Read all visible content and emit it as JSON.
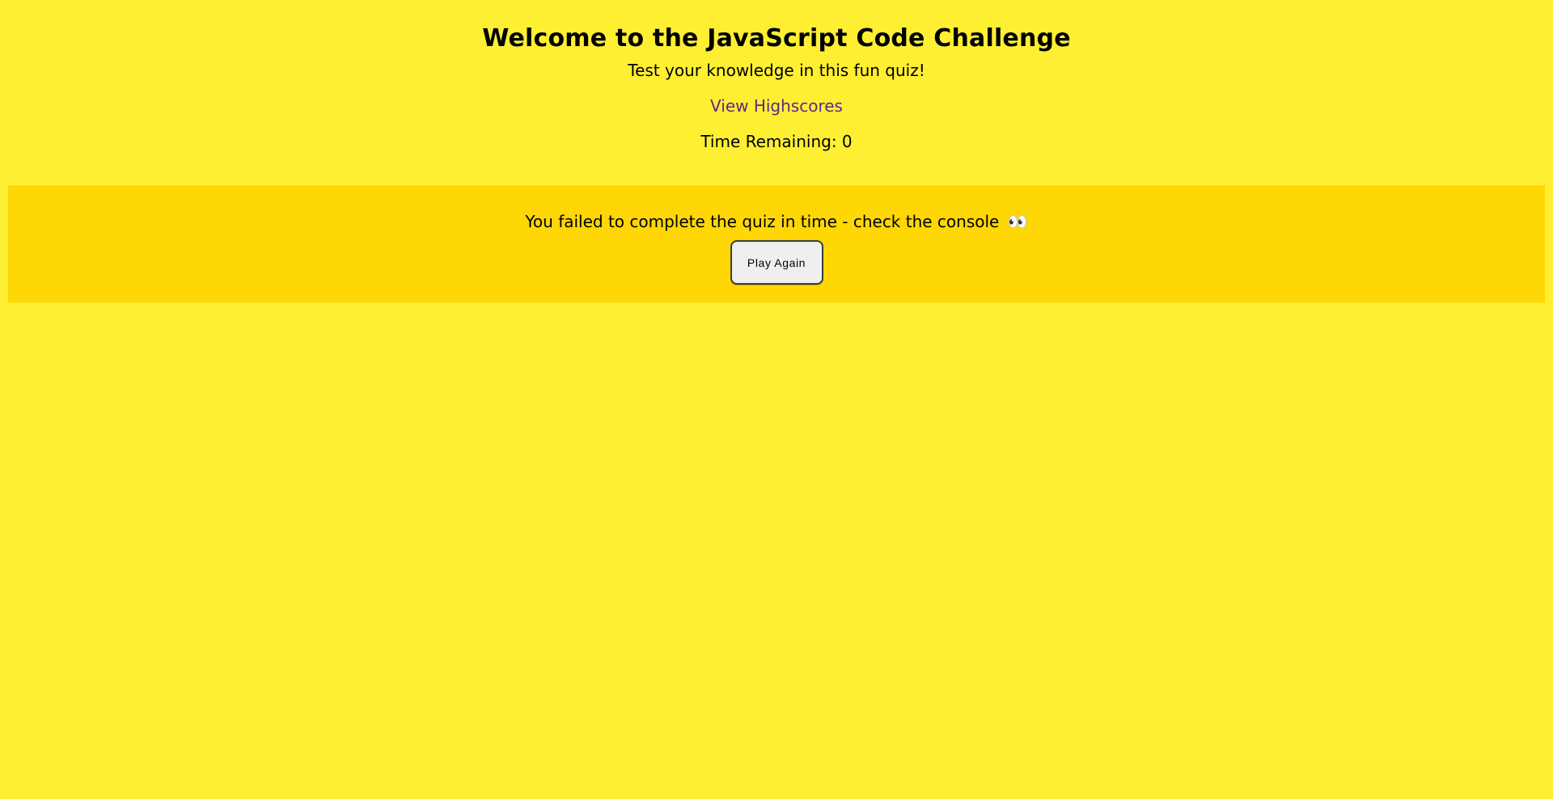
{
  "header": {
    "title": "Welcome to the JavaScript Code Challenge",
    "subtitle": "Test your knowledge in this fun quiz!",
    "highscores_link": "View Highscores",
    "timer_text": "Time Remaining: 0"
  },
  "result_panel": {
    "message": "You failed to complete the quiz in time - check the console",
    "emoji": "👀",
    "play_again_label": "Play Again"
  },
  "colors": {
    "page_background": "#ffef33",
    "panel_background": "#ffd705",
    "link": "#5b2a86"
  }
}
